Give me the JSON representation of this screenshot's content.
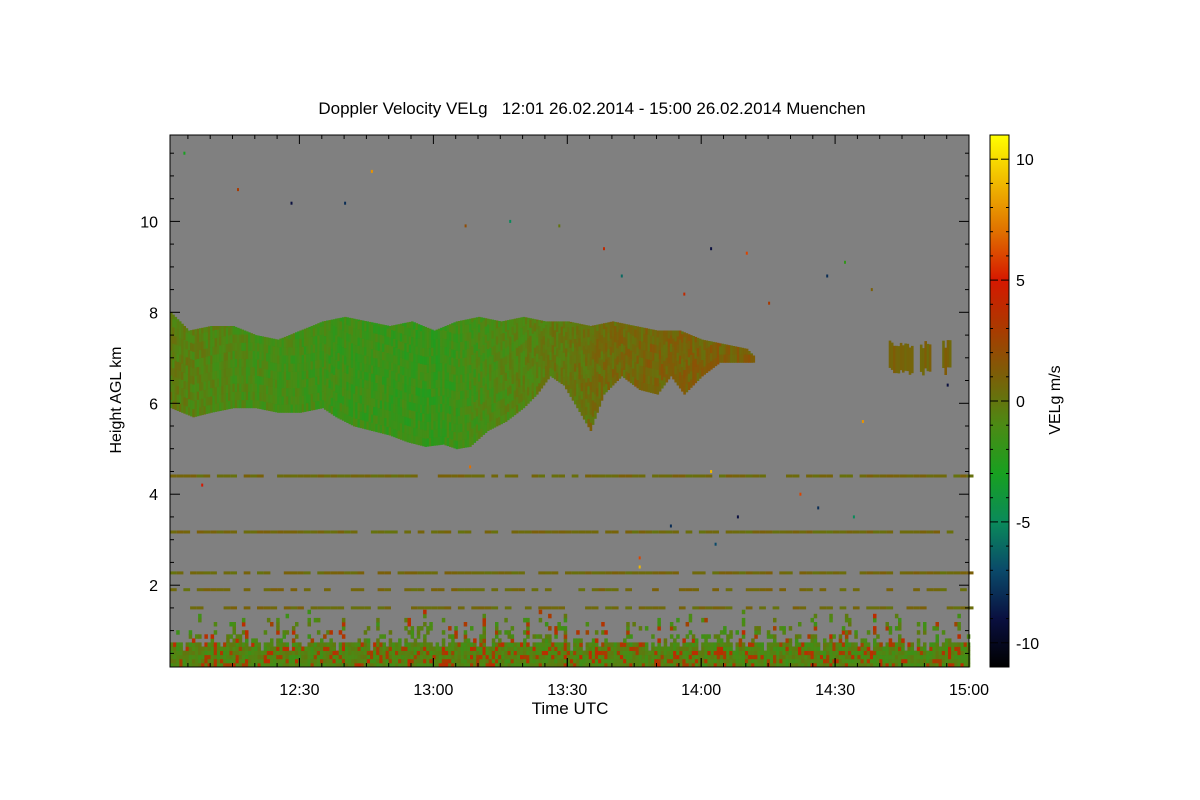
{
  "chart_data": {
    "type": "heatmap",
    "title": "Doppler Velocity VELg   12:01 26.02.2014 - 15:00 26.02.2014 Muenchen",
    "xlabel": "Time UTC",
    "ylabel": "Height AGL km",
    "x_range_minutes": [
      721,
      900
    ],
    "xlim": [
      "12:01",
      "15:00"
    ],
    "ylim": [
      0.2,
      11.9
    ],
    "x_ticks": [
      {
        "minute": 750,
        "label": "12:30"
      },
      {
        "minute": 780,
        "label": "13:00"
      },
      {
        "minute": 810,
        "label": "13:30"
      },
      {
        "minute": 840,
        "label": "14:00"
      },
      {
        "minute": 870,
        "label": "14:30"
      },
      {
        "minute": 900,
        "label": "15:00"
      }
    ],
    "y_ticks": [
      2,
      4,
      6,
      8,
      10
    ],
    "colorbar": {
      "label": "VELg m/s",
      "range": [
        -11,
        11
      ],
      "ticks": [
        -10,
        -5,
        0,
        5,
        10
      ],
      "colormap": [
        "#000000",
        "#0a1040",
        "#0a4a6a",
        "#0a8a5a",
        "#18a020",
        "#4c8a14",
        "#7a6008",
        "#aa3a00",
        "#d61800",
        "#e07000",
        "#f0b800",
        "#ffff00"
      ]
    },
    "background_color": "#808080",
    "cloud_layer": {
      "description_values": "upper cloud layer",
      "base_km": [
        [
          721,
          5.9
        ],
        [
          726,
          5.7
        ],
        [
          730,
          5.8
        ],
        [
          735,
          5.9
        ],
        [
          740,
          5.9
        ],
        [
          745,
          5.8
        ],
        [
          750,
          5.8
        ],
        [
          755,
          5.9
        ],
        [
          758,
          5.7
        ],
        [
          762,
          5.5
        ],
        [
          766,
          5.4
        ],
        [
          770,
          5.3
        ],
        [
          774,
          5.15
        ],
        [
          778,
          5.05
        ],
        [
          782,
          5.1
        ],
        [
          785,
          5.0
        ],
        [
          788,
          5.05
        ],
        [
          792,
          5.4
        ],
        [
          796,
          5.6
        ],
        [
          800,
          5.9
        ],
        [
          803,
          6.2
        ],
        [
          806,
          6.6
        ],
        [
          809,
          6.4
        ],
        [
          812,
          5.9
        ],
        [
          815,
          5.4
        ],
        [
          818,
          6.2
        ],
        [
          822,
          6.6
        ],
        [
          826,
          6.3
        ],
        [
          830,
          6.2
        ],
        [
          833,
          6.6
        ],
        [
          836,
          6.2
        ],
        [
          840,
          6.6
        ],
        [
          844,
          6.9
        ],
        [
          848,
          6.9
        ],
        [
          852,
          6.9
        ]
      ],
      "top_km": [
        [
          721,
          8.0
        ],
        [
          725,
          7.6
        ],
        [
          730,
          7.7
        ],
        [
          735,
          7.7
        ],
        [
          740,
          7.5
        ],
        [
          745,
          7.4
        ],
        [
          750,
          7.6
        ],
        [
          755,
          7.8
        ],
        [
          760,
          7.9
        ],
        [
          765,
          7.8
        ],
        [
          770,
          7.7
        ],
        [
          775,
          7.8
        ],
        [
          780,
          7.6
        ],
        [
          785,
          7.8
        ],
        [
          790,
          7.9
        ],
        [
          795,
          7.8
        ],
        [
          800,
          7.9
        ],
        [
          805,
          7.8
        ],
        [
          810,
          7.8
        ],
        [
          815,
          7.7
        ],
        [
          820,
          7.8
        ],
        [
          825,
          7.7
        ],
        [
          830,
          7.6
        ],
        [
          835,
          7.6
        ],
        [
          840,
          7.4
        ],
        [
          845,
          7.3
        ],
        [
          850,
          7.2
        ],
        [
          852,
          7.0
        ]
      ],
      "velocity_ms": [
        [
          721,
          -0.3
        ],
        [
          740,
          -1.2
        ],
        [
          760,
          -1.6
        ],
        [
          780,
          -1.9
        ],
        [
          800,
          -0.6
        ],
        [
          815,
          0.3
        ],
        [
          830,
          0.9
        ],
        [
          852,
          1.1
        ]
      ]
    },
    "small_cloud": {
      "x_range_minutes": [
        882,
        896
      ],
      "km": [
        6.8,
        7.4
      ],
      "velocity_ms": 0.8
    },
    "horizontal_bands_km": [
      4.4,
      3.17,
      2.27,
      1.9,
      1.5
    ],
    "boundary_layer_km": [
      0.2,
      1.1
    ],
    "scatter_points": [
      [
        724,
        11.5,
        -3
      ],
      [
        736,
        10.7,
        3
      ],
      [
        748,
        10.4,
        -9
      ],
      [
        760,
        10.4,
        -8
      ],
      [
        766,
        11.1,
        8
      ],
      [
        787,
        9.9,
        2
      ],
      [
        797,
        10.0,
        -5
      ],
      [
        808,
        9.9,
        0
      ],
      [
        818,
        9.4,
        4
      ],
      [
        822,
        8.8,
        -6
      ],
      [
        836,
        8.4,
        4
      ],
      [
        842,
        9.4,
        -9
      ],
      [
        850,
        9.3,
        6
      ],
      [
        855,
        8.2,
        3
      ],
      [
        868,
        8.8,
        -8
      ],
      [
        872,
        9.1,
        -2
      ],
      [
        878,
        8.5,
        1
      ],
      [
        895,
        6.4,
        -9
      ],
      [
        848,
        3.5,
        -9
      ],
      [
        833,
        3.3,
        -8
      ],
      [
        843,
        2.9,
        -7
      ],
      [
        866,
        3.7,
        -8
      ],
      [
        862,
        4.0,
        6
      ],
      [
        874,
        3.5,
        -5
      ],
      [
        728,
        4.2,
        5
      ],
      [
        788,
        4.6,
        7
      ],
      [
        842,
        4.5,
        9
      ],
      [
        876,
        5.6,
        8
      ],
      [
        826,
        2.4,
        9
      ],
      [
        826,
        2.6,
        6
      ]
    ]
  }
}
